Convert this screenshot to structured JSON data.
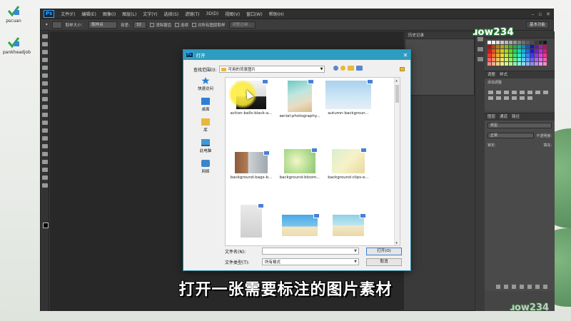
{
  "desktop": {
    "icons": [
      {
        "label": "pscuan"
      },
      {
        "label": "pankheadjob"
      }
    ]
  },
  "photoshop": {
    "logo": "Ps",
    "menu": [
      "文件(F)",
      "编辑(E)",
      "图像(I)",
      "图层(L)",
      "文字(Y)",
      "选择(S)",
      "滤镜(T)",
      "3D(D)",
      "视图(V)",
      "窗口(W)",
      "帮助(H)"
    ],
    "options": {
      "size_label": "取样大小：",
      "size_value": "取样点",
      "tolerance_label": "容差:",
      "tolerance_value": "32",
      "antialias": "消除锯齿",
      "contiguous": "连续",
      "all_layers": "对所有图层取样",
      "refine_button": "调整边缘..."
    },
    "workspace_label": "基本功能",
    "history_tab": "历史记录",
    "adjust_tab_1": "调整",
    "adjust_tab_2": "样式",
    "adjust_title": "添加调整",
    "layers_tabs": [
      "图层",
      "通道",
      "路径"
    ],
    "layers_kind": "类型",
    "layers_blend": "正常",
    "layers_opacity": "不透明度:",
    "layers_lock": "锁定:",
    "layers_fill": "填充:"
  },
  "dialog": {
    "title": "打开",
    "look_in_label": "查找范围(I):",
    "look_in_value": "可用的背景图片",
    "places": [
      {
        "label": "快速访问",
        "icon": "star-icon"
      },
      {
        "label": "桌面",
        "icon": "desktop-icon"
      },
      {
        "label": "库",
        "icon": "library-icon"
      },
      {
        "label": "此电脑",
        "icon": "computer-icon"
      },
      {
        "label": "网络",
        "icon": "network-icon"
      }
    ],
    "files": [
      {
        "name": "action-balls-black-a..."
      },
      {
        "name": "aerial-photography..."
      },
      {
        "name": "autumn-backgroun..."
      },
      {
        "name": "background-bags-b..."
      },
      {
        "name": "background-bloom..."
      },
      {
        "name": "background-clips-e..."
      },
      {
        "name": ""
      },
      {
        "name": ""
      },
      {
        "name": ""
      }
    ],
    "filename_label": "文件名(N):",
    "filename_value": "",
    "filetype_label": "文件类型(T):",
    "filetype_value": "所有格式",
    "open_button": "打开(O)",
    "cancel_button": "取消"
  },
  "watermark": {
    "top_text": "ɹow234",
    "bottom_text": "ɹow234"
  },
  "subtitle": "打开一张需要标注的图片素材",
  "colors": {
    "title_bar": "#2e9cc0",
    "highlight": "#fff350",
    "ps_background": "#3a3a3a"
  }
}
